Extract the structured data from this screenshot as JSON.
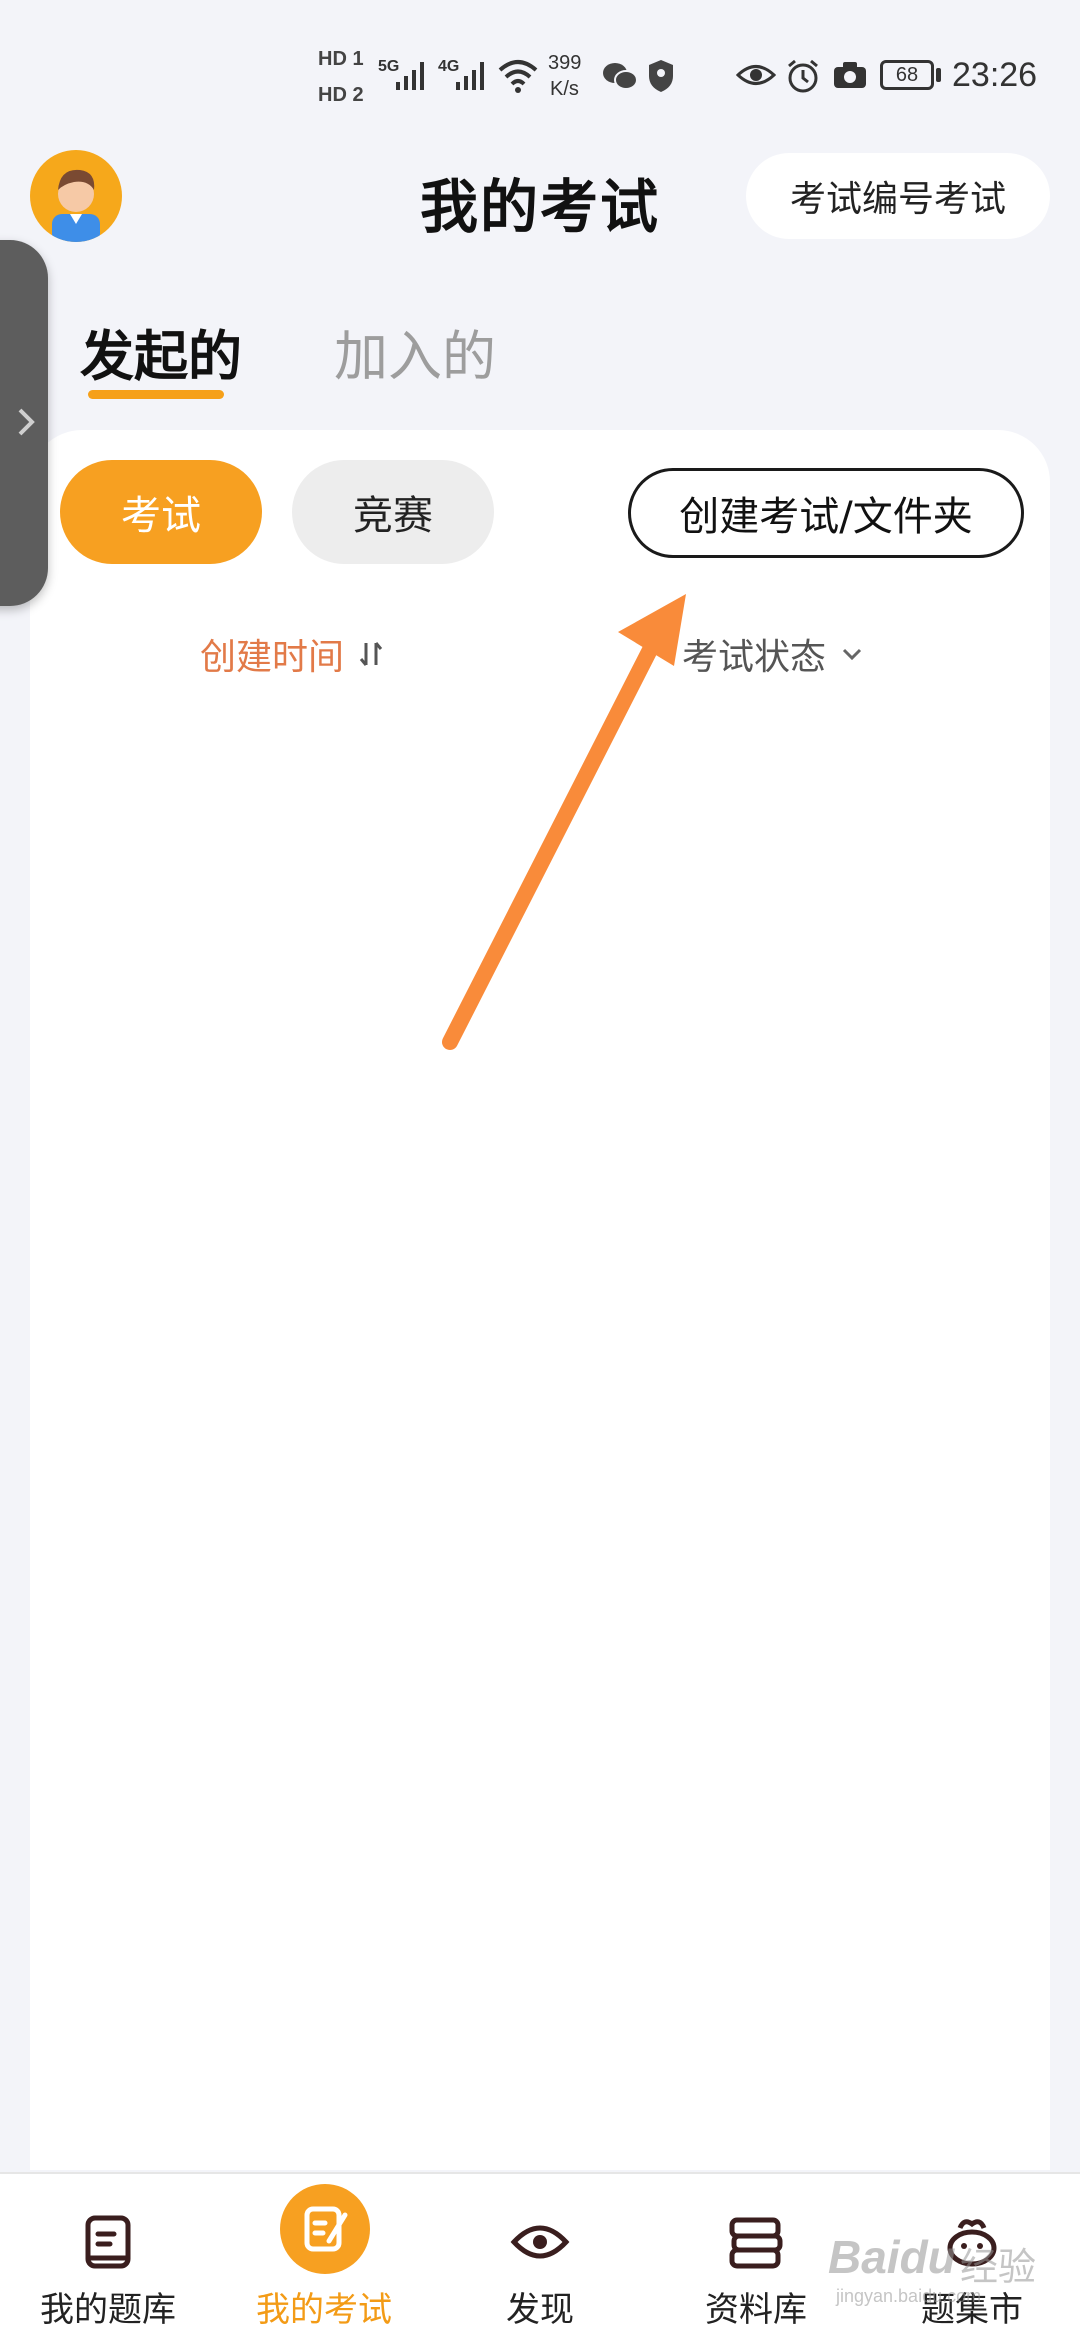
{
  "status_bar": {
    "hd1": "HD 1",
    "hd2": "HD 2",
    "net1": "5G",
    "net2": "4G",
    "speed_value": "399",
    "speed_unit": "K/s",
    "battery": "68",
    "time": "23:26"
  },
  "header": {
    "title": "我的考试",
    "code_exam_button": "考试编号考试"
  },
  "tabs": [
    {
      "label": "发起的",
      "active": true
    },
    {
      "label": "加入的",
      "active": false
    }
  ],
  "chips": {
    "exam": "考试",
    "contest": "竞赛"
  },
  "create_button": "创建考试/文件夹",
  "sort": {
    "created_time": "创建时间",
    "exam_status": "考试状态"
  },
  "bottom_nav": [
    {
      "label": "我的题库",
      "icon": "book-icon"
    },
    {
      "label": "我的考试",
      "icon": "exam-edit-icon",
      "active": true
    },
    {
      "label": "发现",
      "icon": "eye-icon"
    },
    {
      "label": "资料库",
      "icon": "library-icon"
    },
    {
      "label": "题集市",
      "icon": "market-icon"
    }
  ],
  "watermark": {
    "brand": "Baidu",
    "cn": "经验",
    "url": "jingyan.baidu.com"
  },
  "colors": {
    "accent": "#f7a021",
    "arrow": "#f98b3a",
    "sort_active": "#e27a48"
  }
}
